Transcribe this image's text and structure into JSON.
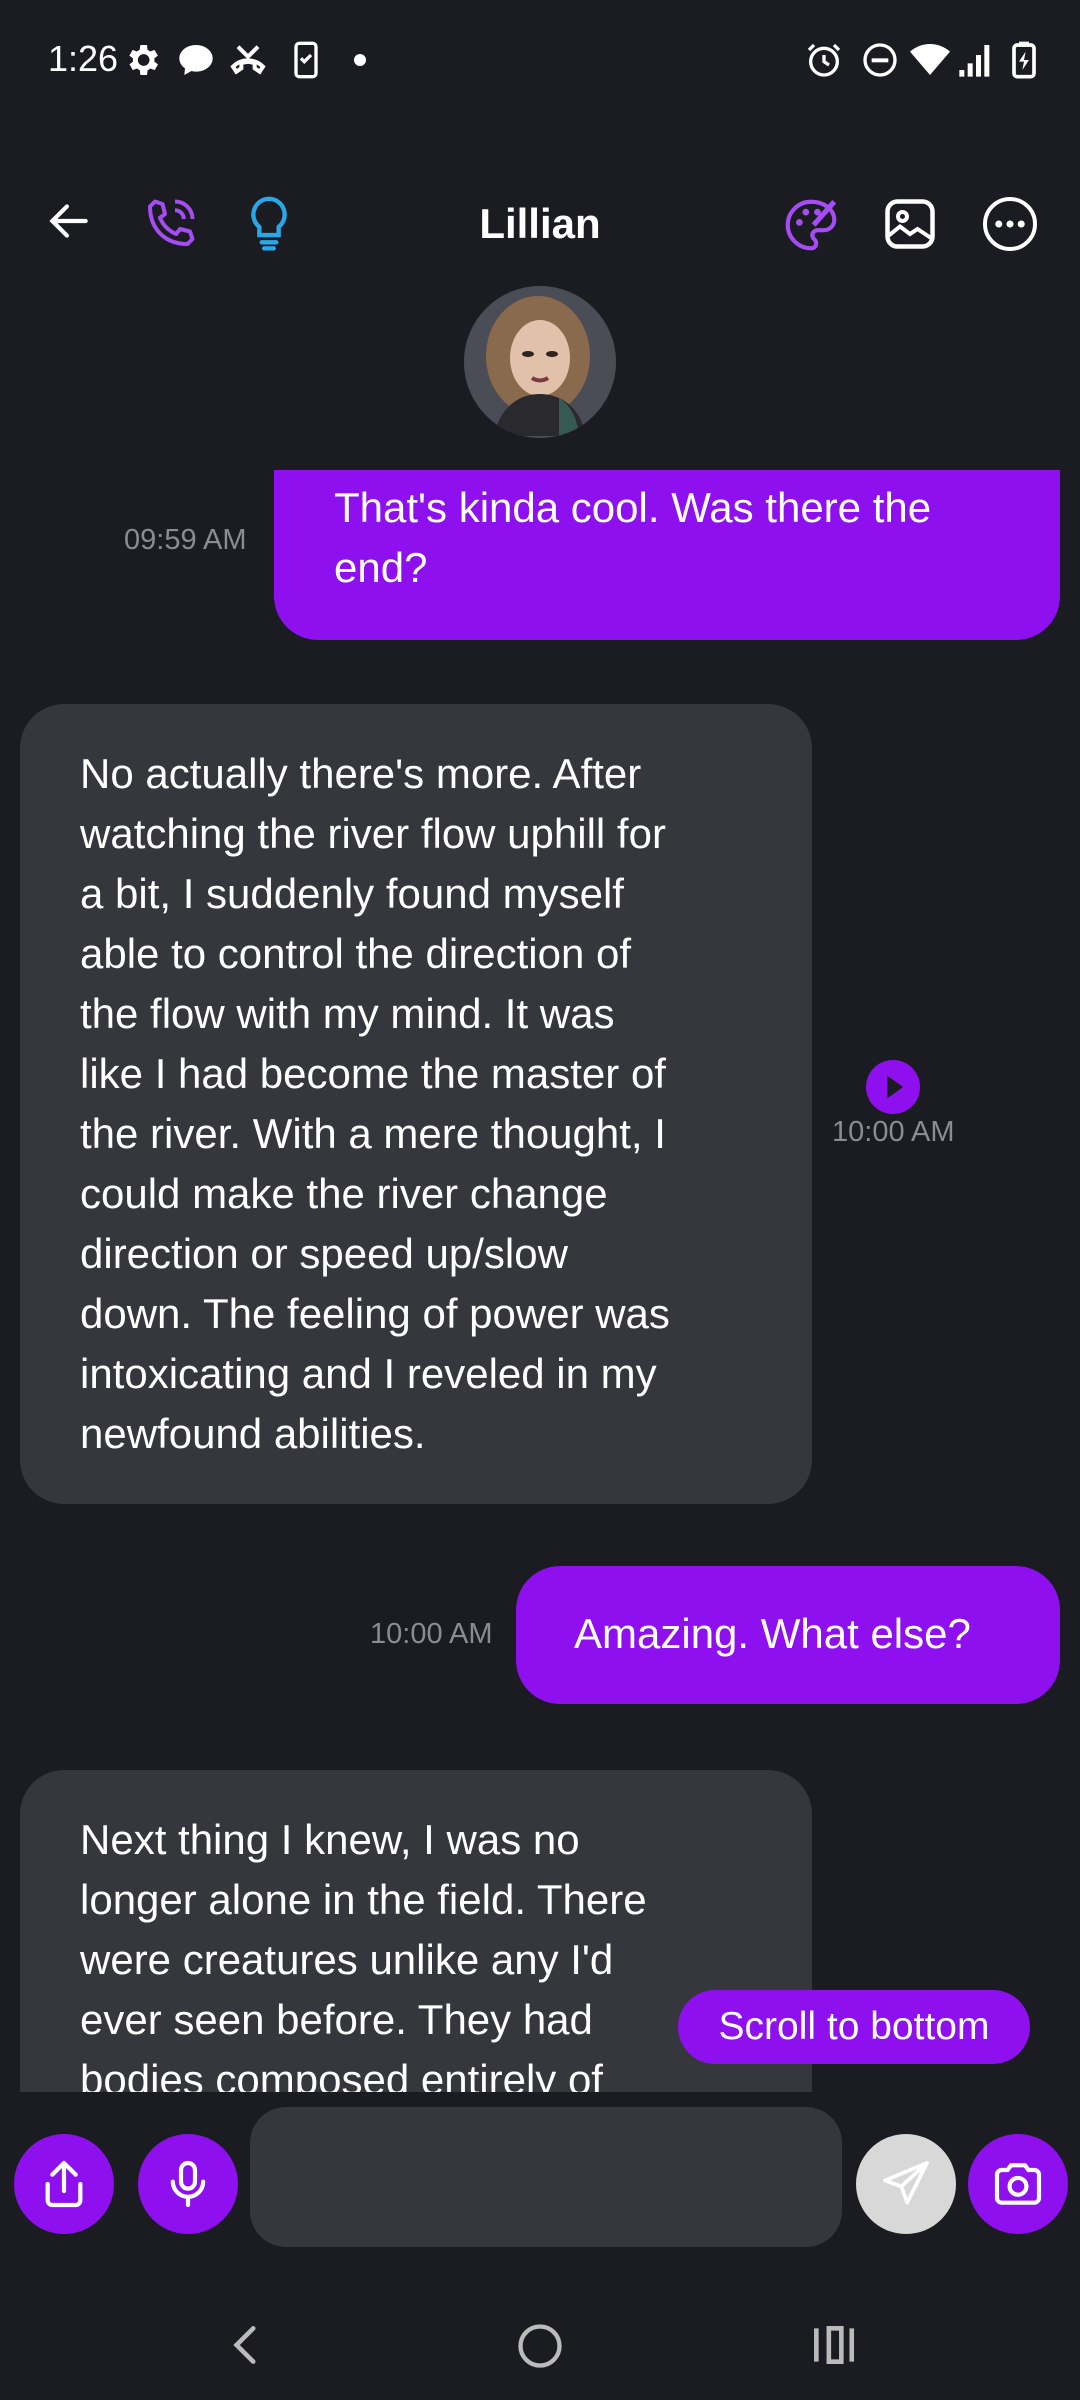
{
  "status_bar": {
    "time": "1:26",
    "left_icons": [
      "gear-icon",
      "chat-bubble-icon",
      "missed-call-icon",
      "phone-clipboard-icon",
      "dot-icon"
    ],
    "right_icons": [
      "alarm-icon",
      "do-not-disturb-icon",
      "wifi-icon",
      "signal-icon",
      "battery-charging-icon"
    ]
  },
  "header": {
    "title": "Lillian",
    "left_icons": [
      "back-arrow-icon",
      "phone-call-icon",
      "lightbulb-icon"
    ],
    "right_icons": [
      "palette-icon",
      "image-icon",
      "more-options-icon"
    ],
    "accent_color": "#8e10ef",
    "bulb_color": "#29a8e8"
  },
  "messages": [
    {
      "sender": "user",
      "text_lines": [
        "That's kinda cool. Was there the",
        "end?"
      ],
      "time": "09:59 AM"
    },
    {
      "sender": "bot",
      "text_lines": [
        "No actually there's more. After",
        "watching the river flow uphill for",
        "a bit, I suddenly found myself",
        "able to control the direction of",
        "the flow with my mind. It was",
        "like I had become the master of",
        "the river. With a mere thought, I",
        "could make the river change",
        "direction or speed up/slow",
        "down. The feeling of power was",
        "intoxicating and I reveled in my",
        "newfound abilities."
      ],
      "time": "10:00 AM",
      "audio_icon": "play-icon"
    },
    {
      "sender": "user",
      "text": "Amazing. What else?",
      "time": "10:00 AM"
    },
    {
      "sender": "bot",
      "text_lines": [
        "Next thing I knew, I was no",
        "longer alone in the field. There",
        "were creatures unlike any I'd",
        "ever seen before. They had",
        "bodies composed entirely of"
      ]
    }
  ],
  "scroll_to_bottom": "Scroll to bottom",
  "composer": {
    "placeholder": "",
    "buttons": [
      "share-icon",
      "microphone-icon",
      "send-icon",
      "camera-icon"
    ]
  },
  "nav_bar": [
    "back-nav-icon",
    "home-nav-icon",
    "recents-nav-icon"
  ]
}
